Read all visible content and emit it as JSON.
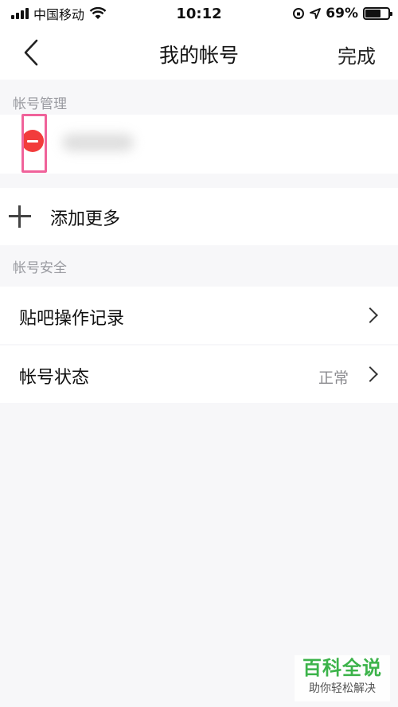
{
  "status_bar": {
    "carrier": "中国移动",
    "time": "10:12",
    "battery": "69%"
  },
  "nav": {
    "title": "我的帐号",
    "done_label": "完成"
  },
  "sections": {
    "account_management": "帐号管理",
    "account_security": "帐号安全"
  },
  "accounts": {
    "add_more_label": "添加更多"
  },
  "security_rows": [
    {
      "label": "贴吧操作记录",
      "value": ""
    },
    {
      "label": "帐号状态",
      "value": "正常"
    }
  ],
  "watermark": {
    "title": "百科全说",
    "subtitle": "助你轻松解决"
  },
  "colors": {
    "remove": "#f23c3c",
    "highlight": "#f0629a",
    "watermark_green": "#3cb34a"
  }
}
